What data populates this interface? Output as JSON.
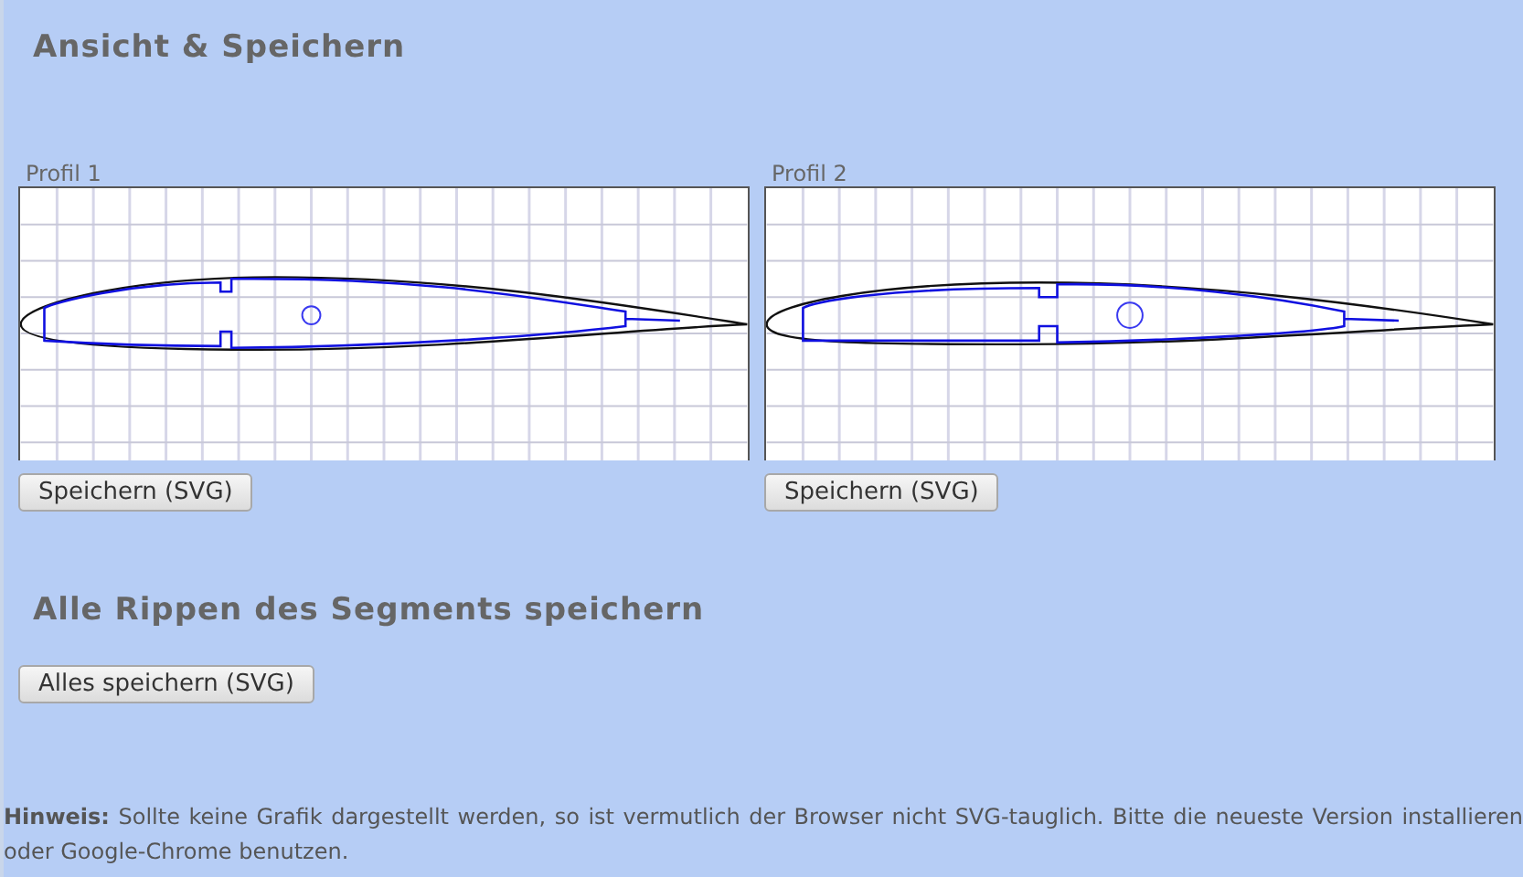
{
  "title": "Ansicht & Speichern",
  "profiles": [
    {
      "label": "Profil 1",
      "button": "Speichern (SVG)"
    },
    {
      "label": "Profil 2",
      "button": "Speichern (SVG)"
    }
  ],
  "segment": {
    "title": "Alle Rippen des Segments speichern",
    "button": "Alles speichern (SVG)"
  },
  "note": "**Hinweis:** Sollte keine Grafik dargestellt werden, so ist vermutlich der Browser nicht SVG-tauglich. Bitte die neueste Version installieren oder Google-Chrome benutzen."
}
